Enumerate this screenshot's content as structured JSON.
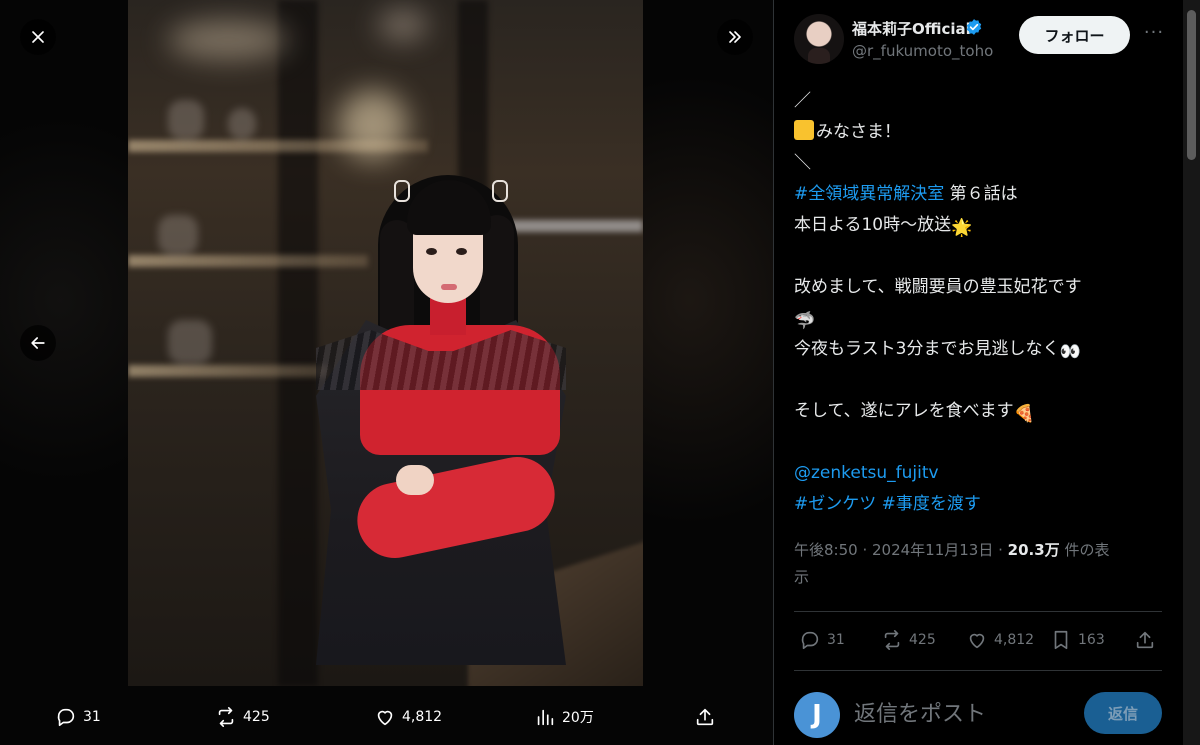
{
  "viewer": {
    "close_icon": "close-icon",
    "expand_icon": "chevrons-right-icon",
    "prev_icon": "arrow-left-icon",
    "actions": {
      "replies": "31",
      "reposts": "425",
      "likes": "4,812",
      "views": "20万"
    }
  },
  "tweet": {
    "author_name": "福本莉子Official",
    "author_handle": "@r_fukumoto_toho",
    "follow_label": "フォロー",
    "more_label": "···",
    "lines": {
      "l1": "／",
      "l2": "みなさま！",
      "l3": "＼",
      "l4_tag": "#全領域異常解決室",
      "l4_rest": " 第６話は",
      "l5": "本日よる10時～放送",
      "l7": "改めまして、戦闘要員の豊玉妃花です",
      "l9": "今夜もラスト3分までお見逃しなく",
      "l11": "そして、遂にアレを食べます",
      "l13_mention": "@zenketsu_fujitv",
      "l14_tag1": "#ゼンケツ",
      "l14_tag2": "#事度を渡す"
    },
    "emoji": {
      "square": "🟨",
      "sun": "🌟",
      "shark": "🦈",
      "eyes": "👀",
      "pizza": "🍕"
    },
    "meta": {
      "time": "午後8:50",
      "sep": " · ",
      "date": "2024年11月13日",
      "views_count": "20.3万",
      "views_suffix_a": " 件の表",
      "views_suffix_b": "示"
    },
    "actions": {
      "replies": "31",
      "reposts": "425",
      "likes": "4,812",
      "bookmarks": "163"
    }
  },
  "reply": {
    "avatar_letter": "J",
    "placeholder": "返信をポスト",
    "button_label": "返信"
  },
  "colors": {
    "link": "#1d9bf0",
    "muted": "#71767b",
    "reply_button": "#1a5f93"
  }
}
